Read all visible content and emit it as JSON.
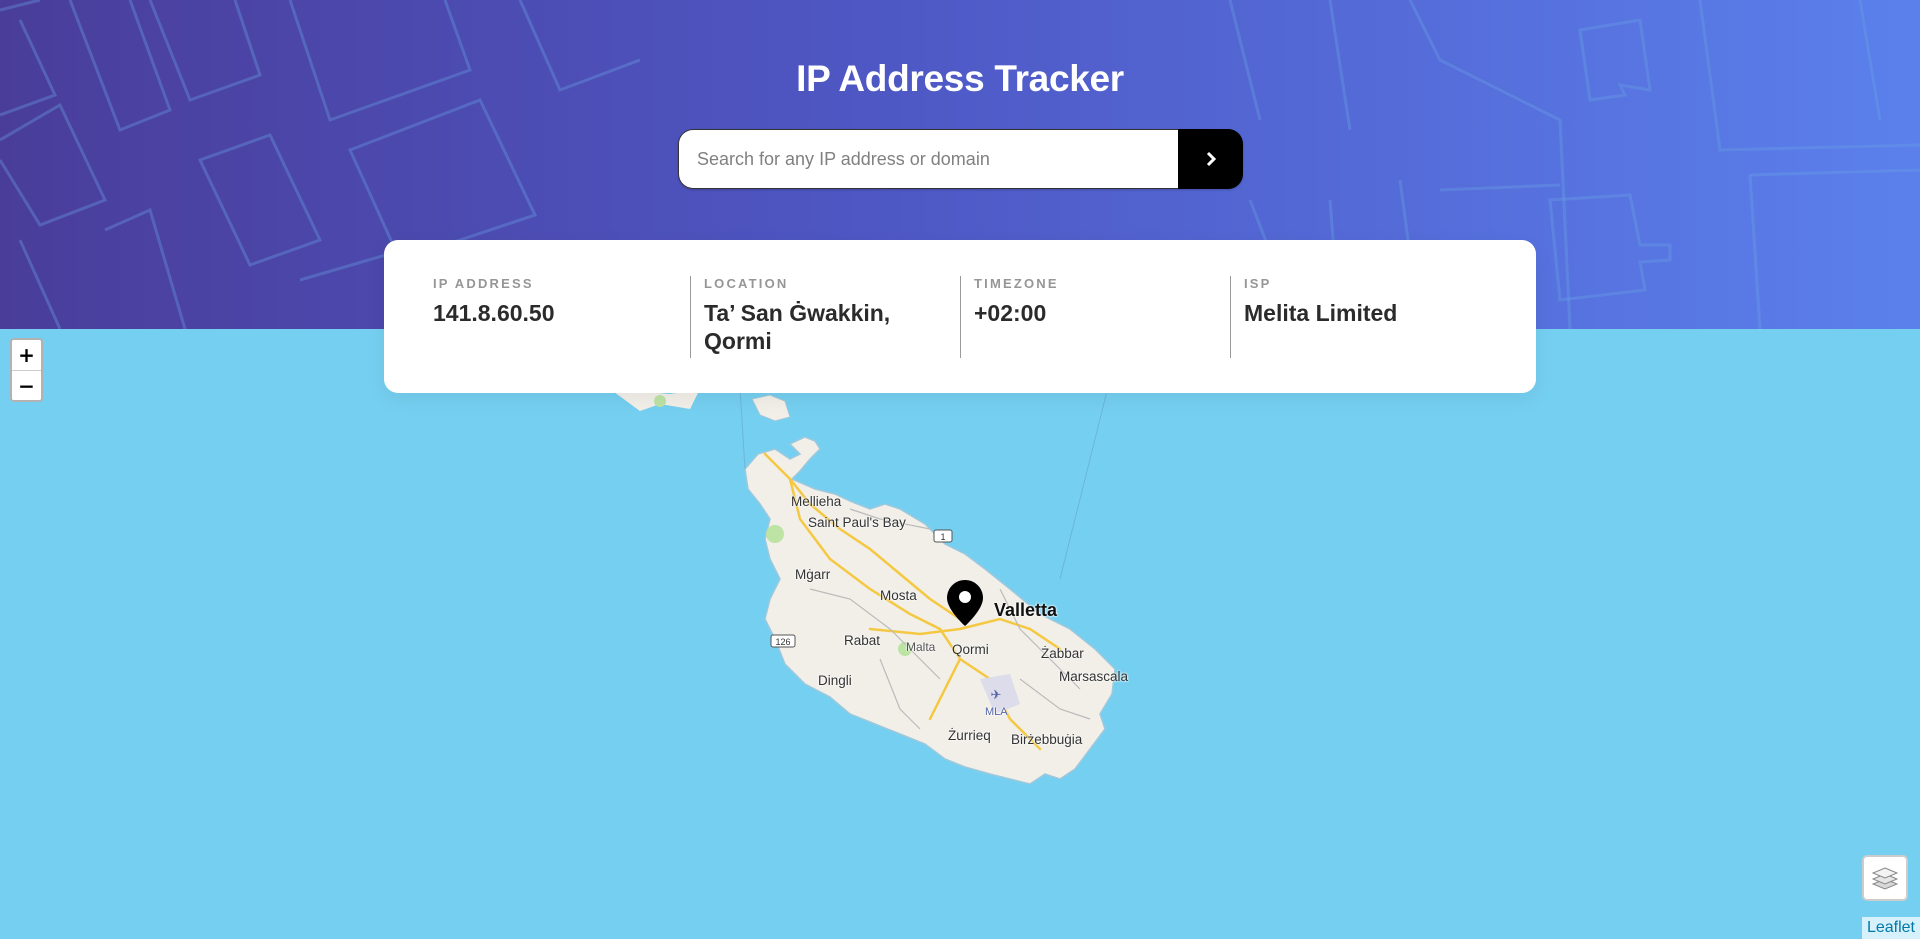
{
  "header": {
    "title": "IP Address Tracker"
  },
  "search": {
    "placeholder": "Search for any IP address or domain",
    "value": "",
    "button_icon": "chevron-right-icon"
  },
  "info": {
    "ip_label": "IP Address",
    "ip_value": "141.8.60.50",
    "location_label": "Location",
    "location_value": "Ta’ San Ġwakkin, Qormi",
    "timezone_label": "Timezone",
    "timezone_value": "+02:00",
    "isp_label": "ISP",
    "isp_value": "Melita Limited"
  },
  "map": {
    "zoom_in": "+",
    "zoom_out": "−",
    "layers_icon": "layers-icon",
    "marker_icon": "location-pin-icon",
    "attribution": "Leaflet",
    "places": [
      "Mellieha",
      "Saint Paul's Bay",
      "Mġarr",
      "Mosta",
      "Valletta",
      "Rabat",
      "Malta",
      "Qormi",
      "Żabbar",
      "Marsascala",
      "Dingli",
      "MLA",
      "Żurrieq",
      "Birżebbuġia"
    ],
    "road_shields": [
      "1",
      "126"
    ]
  },
  "colors": {
    "header_start": "#4a3d9a",
    "header_end": "#5b80ec",
    "water": "#75CFF0",
    "land": "#f2efe9",
    "button": "#000000"
  }
}
